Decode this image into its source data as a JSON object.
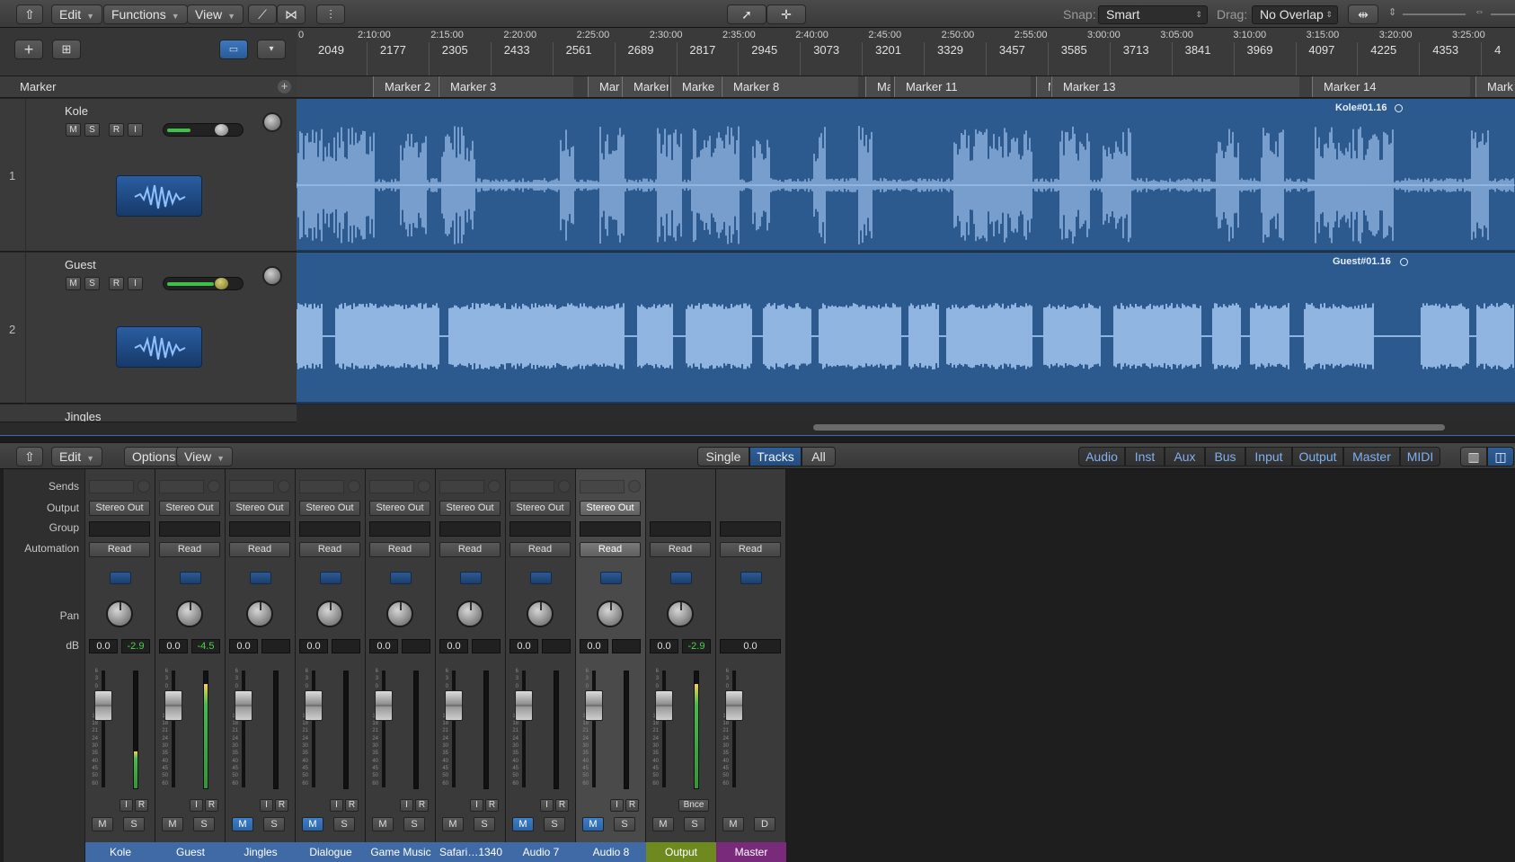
{
  "toolbar": {
    "edit": "Edit",
    "functions": "Functions",
    "view": "View",
    "snap_label": "Snap:",
    "snap_value": "Smart",
    "drag_label": "Drag:",
    "drag_value": "No Overlap"
  },
  "ruler": {
    "times": [
      "2:10:00",
      "2:15:00",
      "2:20:00",
      "2:25:00",
      "2:30:00",
      "2:35:00",
      "2:40:00",
      "2:45:00",
      "2:50:00",
      "2:55:00",
      "3:00:00",
      "3:05:00",
      "3:10:00",
      "3:15:00",
      "3:20:00",
      "3:25:00"
    ],
    "bars": [
      "2049",
      "2177",
      "2305",
      "2433",
      "2561",
      "2689",
      "2817",
      "2945",
      "3073",
      "3201",
      "3329",
      "3457",
      "3585",
      "3713",
      "3841",
      "3969",
      "4097",
      "4225",
      "4353",
      "4"
    ]
  },
  "markers": {
    "header": "Marker",
    "items": [
      "Marker 2",
      "Marker 3",
      "Mar",
      "Marker",
      "Marke",
      "Marker 8",
      "Ma",
      "Marker 11",
      "M",
      "Marker 13",
      "Marker 14",
      "Mark"
    ]
  },
  "tracks": [
    {
      "num": "1",
      "name": "Kole",
      "region": "Kole#01.16"
    },
    {
      "num": "2",
      "name": "Guest",
      "region": "Guest#01.16"
    },
    {
      "num": "",
      "name": "Jingles",
      "region": ""
    }
  ],
  "track_buttons": {
    "m": "M",
    "s": "S",
    "r": "R",
    "i": "I"
  },
  "mixer_toolbar": {
    "edit": "Edit",
    "options": "Options",
    "view": "View",
    "single": "Single",
    "tracks": "Tracks",
    "all": "All",
    "filters": [
      "Audio",
      "Inst",
      "Aux",
      "Bus",
      "Input",
      "Output",
      "Master",
      "MIDI"
    ]
  },
  "mixer_labels": {
    "sends": "Sends",
    "output": "Output",
    "group": "Group",
    "automation": "Automation",
    "pan": "Pan",
    "db": "dB"
  },
  "strip_buttons": {
    "i": "I",
    "r": "R",
    "m": "M",
    "s": "S",
    "d": "D",
    "bnce": "Bnce"
  },
  "strips": [
    {
      "name": "Kole",
      "output": "Stereo Out",
      "automation": "Read",
      "db": "0.0",
      "peak": "-2.9",
      "mute_on": false,
      "meter": 0.31,
      "color": "#3f6aa6"
    },
    {
      "name": "Guest",
      "output": "Stereo Out",
      "automation": "Read",
      "db": "0.0",
      "peak": "-4.5",
      "mute_on": false,
      "meter": 0.88,
      "color": "#3f6aa6"
    },
    {
      "name": "Jingles",
      "output": "Stereo Out",
      "automation": "Read",
      "db": "0.0",
      "peak": "",
      "mute_on": true,
      "meter": 0,
      "color": "#3f6aa6"
    },
    {
      "name": "Dialogue",
      "output": "Stereo Out",
      "automation": "Read",
      "db": "0.0",
      "peak": "",
      "mute_on": true,
      "meter": 0,
      "color": "#3f6aa6"
    },
    {
      "name": "Game Music",
      "output": "Stereo Out",
      "automation": "Read",
      "db": "0.0",
      "peak": "",
      "mute_on": false,
      "meter": 0,
      "color": "#3f6aa6"
    },
    {
      "name": "Safari…1340",
      "output": "Stereo Out",
      "automation": "Read",
      "db": "0.0",
      "peak": "",
      "mute_on": false,
      "meter": 0,
      "color": "#3f6aa6"
    },
    {
      "name": "Audio 7",
      "output": "Stereo Out",
      "automation": "Read",
      "db": "0.0",
      "peak": "",
      "mute_on": true,
      "meter": 0,
      "color": "#3f6aa6"
    },
    {
      "name": "Audio 8",
      "output": "Stereo Out",
      "automation": "Read",
      "db": "0.0",
      "peak": "",
      "mute_on": true,
      "meter": 0,
      "color": "#3f6aa6"
    },
    {
      "name": "Output",
      "output": "",
      "automation": "Read",
      "db": "0.0",
      "peak": "-2.9",
      "mute_on": false,
      "meter": 0.88,
      "color": "#6e8a1e"
    },
    {
      "name": "Master",
      "output": "",
      "automation": "Read",
      "db": "0.0",
      "peak": "",
      "mute_on": false,
      "meter": 0,
      "color": "#7a2a7a"
    }
  ]
}
